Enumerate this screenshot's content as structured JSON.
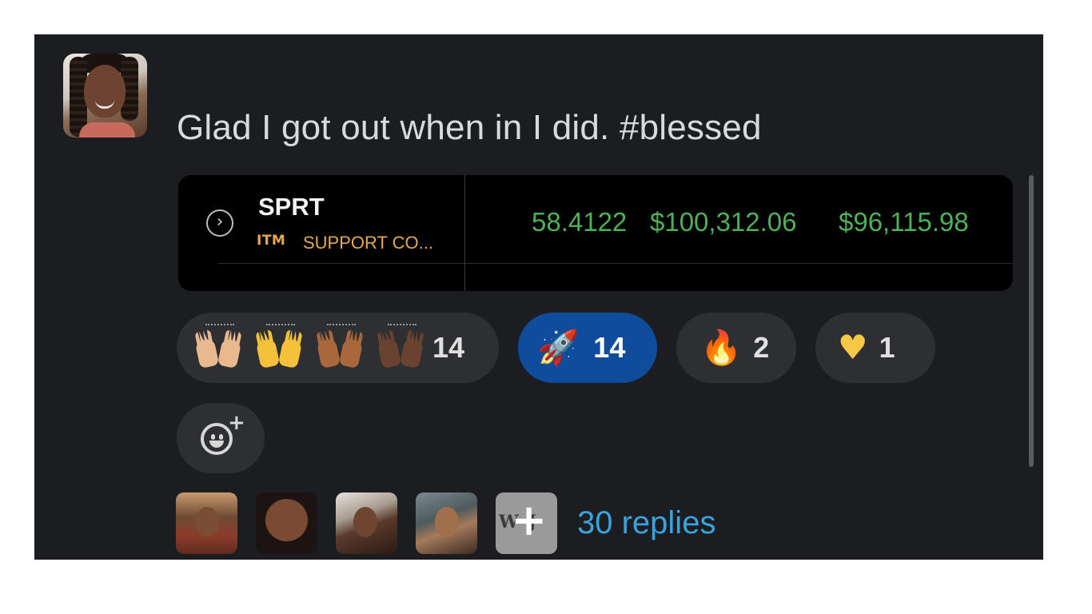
{
  "message": {
    "text": "Glad I got out when in I did. #blessed"
  },
  "stock_card": {
    "chevron_icon": "chevron-right-circle-icon",
    "ticker": "SPRT",
    "badge": "ITM",
    "company": "SUPPORT CO...",
    "values": [
      "58.4122",
      "$100,312.06",
      "$96,115.98"
    ],
    "value_color": "#4fb05a",
    "badge_color": "#e3a955"
  },
  "reactions": [
    {
      "icon": "raised-hands-icon",
      "count": "14",
      "active": false
    },
    {
      "icon": "rocket-icon",
      "glyph": "🚀",
      "count": "14",
      "active": true
    },
    {
      "icon": "fire-icon",
      "glyph": "🔥",
      "count": "2",
      "active": false
    },
    {
      "icon": "yellow-heart-icon",
      "glyph": "♥",
      "count": "1",
      "active": false
    }
  ],
  "add_reaction": {
    "icon": "add-emoji-icon"
  },
  "thread": {
    "replies_label": "30 replies",
    "more_icon": "plus-icon"
  },
  "colors": {
    "panel_bg": "#1b1d21",
    "pill_bg": "#2d2f33",
    "active_pill_bg": "#0f4c9c",
    "link": "#3aa3dc"
  }
}
